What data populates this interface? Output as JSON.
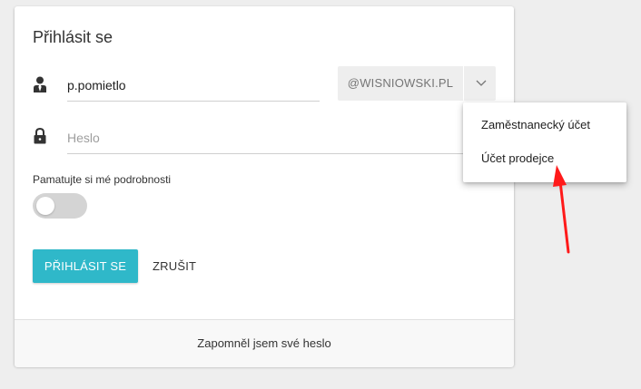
{
  "login_card": {
    "title": "Přihlásit se",
    "username": {
      "value": "p.pomietlo",
      "icon": "user-tie-icon"
    },
    "domain": {
      "selected": "@WISNIOWSKI.PL",
      "icon": "chevron-down-icon"
    },
    "password": {
      "placeholder": "Heslo",
      "value": "",
      "icon": "lock-icon"
    },
    "remember": {
      "label": "Pamatujte si mé podrobnosti",
      "checked": false
    },
    "login_label": "PŘIHLÁSIT SE",
    "cancel_label": "ZRUŠIT",
    "forgot_link": "Zapomněl jsem své heslo"
  },
  "domain_menu": {
    "items": [
      {
        "label": "Zaměstnanecký účet"
      },
      {
        "label": "Účet prodejce"
      }
    ]
  },
  "colors": {
    "accent": "#2fb8c9",
    "annotation_arrow": "#ff1a1a",
    "background": "#eeeeee"
  }
}
